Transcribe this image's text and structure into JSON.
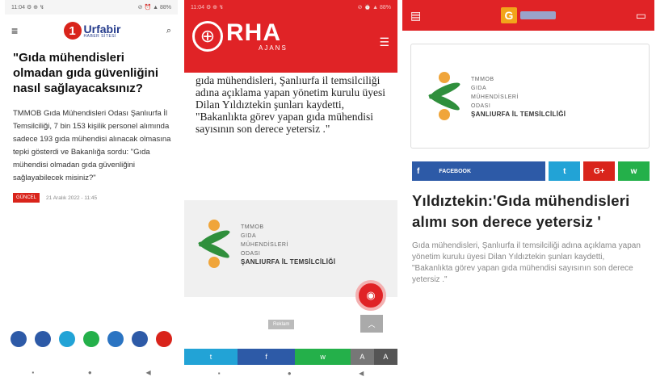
{
  "screen1": {
    "status_left": "11:04 ⚙ ⊕ ↯",
    "status_right": "⊘ ⏰ ▲ 88%",
    "logo_number": "1",
    "logo_name": "Urfabir",
    "logo_sub": "HABER SİTESİ",
    "title": "\"Gıda mühendisleri olmadan gıda güvenliğini nasıl sağlayacaksınız?",
    "body": "TMMOB Gıda Mühendisleri Odası Şanlıurfa İl Temsilciliği, 7 bin 153 kişilik personel alımında sadece 193 gıda mühendisi alınacak olmasına tepki gösterdi ve Bakanlığa sordu: \"Gıda mühendisi olmadan gıda güvenliğini sağlayabilecek misiniz?\"",
    "category": "GÜNCEL",
    "date": "21 Aralık 2022 - 11:45",
    "share_colors": [
      "#2d5aa7",
      "#2d5aa7",
      "#22a3d6",
      "#24b04a",
      "#2b74c2",
      "#2d5aa7",
      "#d9241b"
    ]
  },
  "screen2": {
    "status_left": "11:04 ⚙ ⊕ ↯",
    "status_right": "⊘ ⏰ ▲ 88%",
    "logo_name": "RHA",
    "logo_sub": "AJANS",
    "body": "gıda mühendisleri, Şanlıurfa il temsilciliği adına açıklama yapan yönetim kurulu üyesi Dilan Yıldıztekin şunları kaydetti, \"Bakanlıkta görev yapan gıda mühendisi sayısının son derece yetersiz .\"",
    "org_lines": [
      "TMMOB",
      "GIDA",
      "MÜHENDİSLERİ",
      "ODASI"
    ],
    "org_last": "ŞANLIURFA İL TEMSİLCİLİĞİ",
    "ad_chip": "Reklam",
    "share_labels": [
      "t",
      "f",
      "w",
      "A",
      "A"
    ],
    "share_colors": [
      "#22a3d6",
      "#2d5aa7",
      "#24b04a",
      "#777777",
      "#555555"
    ]
  },
  "screen3": {
    "org_lines": [
      "TMMOB",
      "GIDA",
      "MÜHENDİSLERİ",
      "ODASI"
    ],
    "org_last": "ŞANLIURFA İL TEMSİLCİLİĞİ",
    "facebook_label": "FACEBOOK",
    "share_labels": [
      "f",
      "t",
      "G+",
      "w"
    ],
    "share_colors": [
      "#2d5aa7",
      "#22a3d6",
      "#d9241b",
      "#24b04a"
    ],
    "title": "Yıldıztekin:'Gıda mühendisleri alımı son derece yetersiz '",
    "body": "Gıda mühendisleri, Şanlıurfa il temsilciliği adına açıklama yapan yönetim kurulu üyesi Dilan Yıldıztekin şunları kaydetti, \"Bakanlıkta görev yapan gıda mühendisi sayısının son derece yetersiz .\""
  }
}
